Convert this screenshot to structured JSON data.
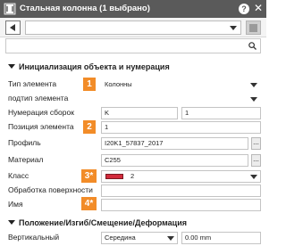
{
  "title": "Стальная колонна (1 выбрано)",
  "help_glyph": "?",
  "close_glyph": "✕",
  "toolbar": {
    "select_value": ""
  },
  "search": {
    "value": ""
  },
  "sections": {
    "init": "Инициализация объекта и нумерация",
    "position": "Положение/Изгиб/Смещение/Деформация"
  },
  "fields": {
    "element_type": {
      "label": "Тип элемента",
      "value": "Колонны",
      "badge": "1"
    },
    "element_subtype": {
      "label": "подтип элемента",
      "value": ""
    },
    "assembly_numbering": {
      "label": "Нумерация сборок",
      "prefix": "K",
      "start": "1"
    },
    "element_position": {
      "label": "Позиция элемента",
      "value": "1",
      "badge": "2"
    },
    "profile": {
      "label": "Профиль",
      "value": "I20K1_57837_2017",
      "dots": "..."
    },
    "material": {
      "label": "Материал",
      "value": "C255",
      "dots": "..."
    },
    "class": {
      "label": "Класс",
      "value": "2",
      "badge": "3*",
      "swatch_color": "#d22b3c"
    },
    "surface": {
      "label": "Обработка поверхности",
      "value": ""
    },
    "name": {
      "label": "Имя",
      "value": "",
      "badge": "4*"
    },
    "vertical": {
      "label": "Вертикальный",
      "value": "Середина",
      "offset": "0.00 mm"
    }
  },
  "colors": {
    "titlebar": "#5a5a5a",
    "badge": "#f28c28"
  }
}
